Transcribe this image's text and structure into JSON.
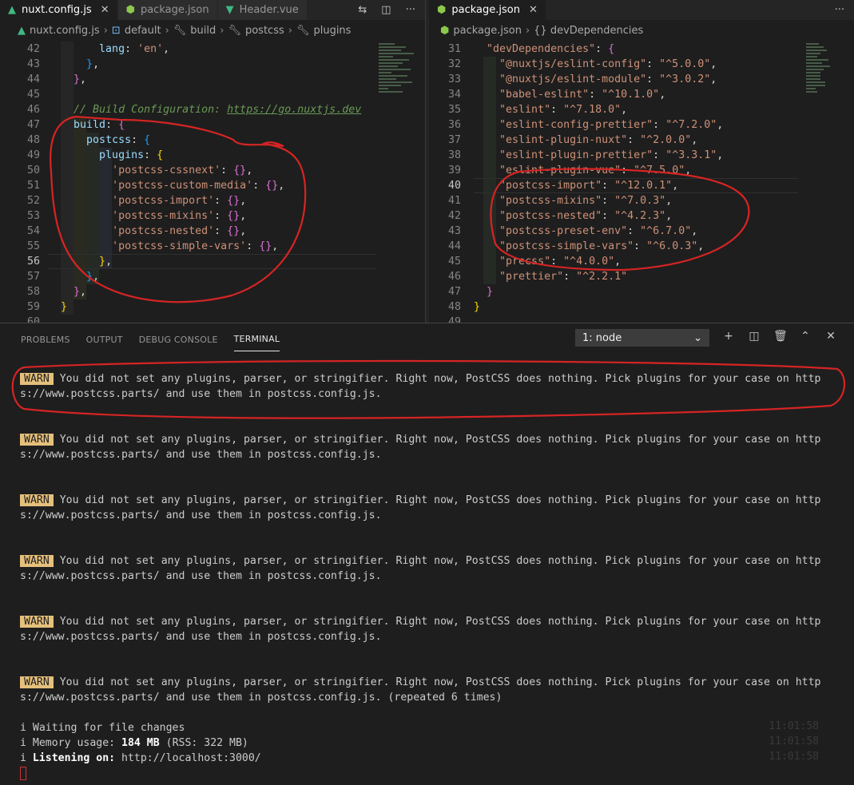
{
  "left_editor": {
    "tabs": [
      {
        "label": "nuxt.config.js",
        "icon": "nuxt-icon",
        "active": true
      },
      {
        "label": "package.json",
        "icon": "nodejs-icon",
        "active": false
      },
      {
        "label": "Header.vue",
        "icon": "vue-icon",
        "active": false
      }
    ],
    "breadcrumb": [
      "nuxt.config.js",
      "default",
      "build",
      "postcss",
      "plugins"
    ],
    "lines": [
      {
        "n": "42",
        "html": "        <span class='k'>lang</span><span class='p'>: </span><span class='s'>'en'</span><span class='p'>,</span>"
      },
      {
        "n": "43",
        "html": "      <span class='b3'>}</span><span class='p'>,</span>"
      },
      {
        "n": "44",
        "html": "    <span class='b2'>}</span><span class='p'>,</span>"
      },
      {
        "n": "45",
        "html": ""
      },
      {
        "n": "46",
        "html": "    <span class='cm'>// Build Configuration: </span><span class='cmu'>https://go.nuxtjs.dev</span>"
      },
      {
        "n": "47",
        "html": "    <span class='k'>build</span><span class='p'>: </span><span class='b2'>{</span>"
      },
      {
        "n": "48",
        "html": "      <span class='k'>postcss</span><span class='p'>: </span><span class='b3'>{</span>"
      },
      {
        "n": "49",
        "html": "        <span class='k'>plugins</span><span class='p'>: </span><span class='b1'>{</span>"
      },
      {
        "n": "50",
        "html": "          <span class='s'>'postcss-cssnext'</span><span class='p'>: </span><span class='b2'>{}</span><span class='p'>,</span>"
      },
      {
        "n": "51",
        "html": "          <span class='s'>'postcss-custom-media'</span><span class='p'>: </span><span class='b2'>{}</span><span class='p'>,</span>"
      },
      {
        "n": "52",
        "html": "          <span class='s'>'postcss-import'</span><span class='p'>: </span><span class='b2'>{}</span><span class='p'>,</span>"
      },
      {
        "n": "53",
        "html": "          <span class='s'>'postcss-mixins'</span><span class='p'>: </span><span class='b2'>{}</span><span class='p'>,</span>"
      },
      {
        "n": "54",
        "html": "          <span class='s'>'postcss-nested'</span><span class='p'>: </span><span class='b2'>{}</span><span class='p'>,</span>"
      },
      {
        "n": "55",
        "html": "          <span class='s'>'postcss-simple-vars'</span><span class='p'>: </span><span class='b2'>{}</span><span class='p'>,</span>"
      },
      {
        "n": "56",
        "html": "        <span class='b1'>}</span><span class='p'>,</span>"
      },
      {
        "n": "57",
        "html": "      <span class='b3'>}</span><span class='p'>,</span>"
      },
      {
        "n": "58",
        "html": "    <span class='b2'>}</span><span class='p'>,</span>"
      },
      {
        "n": "59",
        "html": "  <span class='b1'>}</span>"
      },
      {
        "n": "60",
        "html": ""
      }
    ],
    "current_line": "56"
  },
  "right_editor": {
    "tabs": [
      {
        "label": "package.json",
        "icon": "nodejs-icon",
        "active": true
      }
    ],
    "breadcrumb": [
      "package.json",
      "{} devDependencies"
    ],
    "lines": [
      {
        "n": "31",
        "html": "  <span class='jk'>\"devDependencies\"</span><span class='p'>: </span><span class='b2'>{</span>"
      },
      {
        "n": "32",
        "html": "    <span class='jk'>\"@nuxtjs/eslint-config\"</span><span class='p'>: </span><span class='s2'>\"^5.0.0\"</span><span class='p'>,</span>"
      },
      {
        "n": "33",
        "html": "    <span class='jk'>\"@nuxtjs/eslint-module\"</span><span class='p'>: </span><span class='s2'>\"^3.0.2\"</span><span class='p'>,</span>"
      },
      {
        "n": "34",
        "html": "    <span class='jk'>\"babel-eslint\"</span><span class='p'>: </span><span class='s2'>\"^10.1.0\"</span><span class='p'>,</span>"
      },
      {
        "n": "35",
        "html": "    <span class='jk'>\"eslint\"</span><span class='p'>: </span><span class='s2'>\"^7.18.0\"</span><span class='p'>,</span>"
      },
      {
        "n": "36",
        "html": "    <span class='jk'>\"eslint-config-prettier\"</span><span class='p'>: </span><span class='s2'>\"^7.2.0\"</span><span class='p'>,</span>"
      },
      {
        "n": "37",
        "html": "    <span class='jk'>\"eslint-plugin-nuxt\"</span><span class='p'>: </span><span class='s2'>\"^2.0.0\"</span><span class='p'>,</span>"
      },
      {
        "n": "38",
        "html": "    <span class='jk'>\"eslint-plugin-prettier\"</span><span class='p'>: </span><span class='s2'>\"^3.3.1\"</span><span class='p'>,</span>"
      },
      {
        "n": "39",
        "html": "    <span class='jk'>\"eslint-plugin-vue\"</span><span class='p'>: </span><span class='s2'>\"^7.5.0\"</span><span class='p'>,</span>"
      },
      {
        "n": "40",
        "html": "    <span class='jk'>\"postcss-import\"</span><span class='p'>: </span><span class='s2'>\"^12.0.1\"</span><span class='p'>,</span>"
      },
      {
        "n": "41",
        "html": "    <span class='jk'>\"postcss-mixins\"</span><span class='p'>: </span><span class='s2'>\"^7.0.3\"</span><span class='p'>,</span>"
      },
      {
        "n": "42",
        "html": "    <span class='jk'>\"postcss-nested\"</span><span class='p'>: </span><span class='s2'>\"^4.2.3\"</span><span class='p'>,</span>"
      },
      {
        "n": "43",
        "html": "    <span class='jk'>\"postcss-preset-env\"</span><span class='p'>: </span><span class='s2'>\"^6.7.0\"</span><span class='p'>,</span>"
      },
      {
        "n": "44",
        "html": "    <span class='jk'>\"postcss-simple-vars\"</span><span class='p'>: </span><span class='s2'>\"^6.0.3\"</span><span class='p'>,</span>"
      },
      {
        "n": "45",
        "html": "    <span class='jk'>\"precss\"</span><span class='p'>: </span><span class='s2'>\"^4.0.0\"</span><span class='p'>,</span>"
      },
      {
        "n": "46",
        "html": "    <span class='jk'>\"prettier\"</span><span class='p'>: </span><span class='s2'>\"^2.2.1\"</span>"
      },
      {
        "n": "47",
        "html": "  <span class='b2'>}</span>"
      },
      {
        "n": "48",
        "html": "<span class='b1'>}</span>"
      },
      {
        "n": "49",
        "html": ""
      }
    ],
    "current_line": "40"
  },
  "panel": {
    "tabs": [
      "PROBLEMS",
      "OUTPUT",
      "DEBUG CONSOLE",
      "TERMINAL"
    ],
    "active_tab": "TERMINAL",
    "terminal_select": "1: node",
    "warn_label": "WARN",
    "warn_line1": " You did not set any plugins, parser, or stringifier. Right now, PostCSS does nothing. Pick plugins for your case on http",
    "warn_line2": "s://www.postcss.parts/ and use them in postcss.config.js.",
    "warn_line2_last": "s://www.postcss.parts/ and use them in postcss.config.js. (repeated 6 times)",
    "status": [
      {
        "prefix": "i ",
        "text": "Waiting for file changes",
        "time": "11:01:58"
      },
      {
        "prefix": "i ",
        "text": "Memory usage: ",
        "bold": "184 MB",
        "rest": " (RSS: 322 MB)",
        "time": "11:01:58"
      },
      {
        "prefix": "i ",
        "bold_label": "Listening on:",
        "rest": " http://localhost:3000/",
        "time": "11:01:58"
      }
    ]
  },
  "colors": {
    "annotation_red": "#d62424",
    "warn_badge": "#e5c07b"
  }
}
